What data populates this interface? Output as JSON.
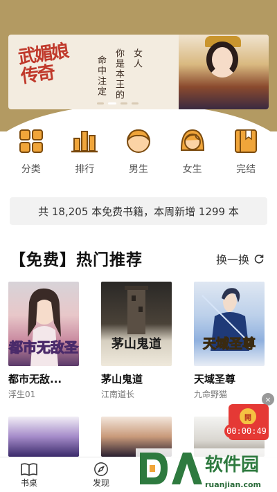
{
  "banner": {
    "title": "武媚娘传奇",
    "lines": [
      "女人",
      "你是本王的",
      "命中注定"
    ],
    "dots": 4,
    "active_dot": 1
  },
  "categories": [
    {
      "label": "分类",
      "icon": "grid-icon"
    },
    {
      "label": "排行",
      "icon": "bar-chart-icon"
    },
    {
      "label": "男生",
      "icon": "male-avatar-icon"
    },
    {
      "label": "女生",
      "icon": "female-avatar-icon"
    },
    {
      "label": "完结",
      "icon": "book-bookmark-icon"
    }
  ],
  "info_bar": "共 18,205 本免费书籍，本周新增 1299 本",
  "section": {
    "title": "【免费】热门推荐",
    "refresh_label": "换一换"
  },
  "books": [
    {
      "title": "都市无敌...",
      "author": "浮生01",
      "cover_text": "都市无敌圣"
    },
    {
      "title": "茅山鬼道",
      "author": "江南道长",
      "cover_text": "茅山鬼道"
    },
    {
      "title": "天域圣尊",
      "author": "九命野猫",
      "cover_text": "天域圣尊"
    }
  ],
  "floating_bonus": {
    "badge": "開",
    "timer": "00:00:49",
    "close": "×"
  },
  "bottom_nav": [
    {
      "label": "书桌",
      "icon": "open-book-icon"
    },
    {
      "label": "发现",
      "icon": "compass-icon"
    }
  ],
  "watermark": {
    "brand": "软件园",
    "site": "ruanjian.com"
  },
  "colors": {
    "header": "#b39a62",
    "accent_orange": "#f0a53a",
    "icon_dark": "#8a5a12",
    "red": "#e53935"
  }
}
